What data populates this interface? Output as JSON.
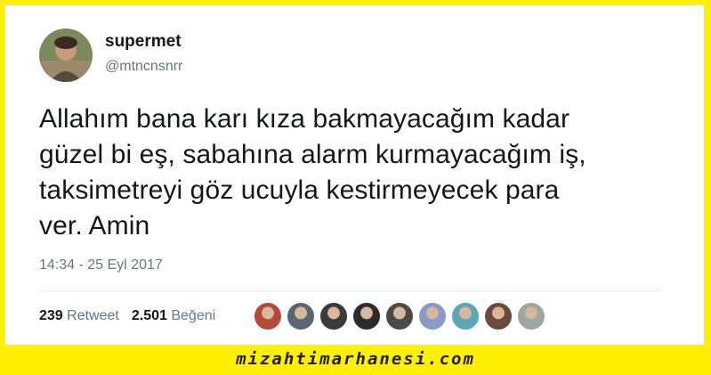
{
  "tweet": {
    "display_name": "supermet",
    "handle": "@mtncnsnrr",
    "text_lines": [
      "Allahım bana karı kıza bakmayacağım kadar",
      "güzel bi eş, sabahına alarm kurmayacağım iş,",
      "taksimetreyi göz ucuyla kestirmeyecek para",
      "ver. Amin"
    ],
    "timestamp": "14:34 - 25 Eyl 2017",
    "retweet_count": "239",
    "retweet_label": "Retweet",
    "like_count": "2.501",
    "like_label": "Beğeni"
  },
  "liker_avatars": [
    {
      "icon": "user-avatar-icon",
      "color": "#b34a3a"
    },
    {
      "icon": "user-avatar-icon",
      "color": "#5a6670"
    },
    {
      "icon": "user-avatar-icon",
      "color": "#3a3a3a"
    },
    {
      "icon": "user-avatar-icon",
      "color": "#2c2c2c"
    },
    {
      "icon": "user-avatar-icon",
      "color": "#4a4a4a"
    },
    {
      "icon": "user-avatar-icon",
      "color": "#8a9ac8"
    },
    {
      "icon": "user-avatar-icon",
      "color": "#5aa7b8"
    },
    {
      "icon": "user-avatar-icon",
      "color": "#6a4a3a"
    },
    {
      "icon": "user-avatar-icon",
      "color": "#9aa8a0"
    }
  ],
  "watermark": "mizahtimarhanesi.com",
  "colors": {
    "background_frame": "#ffef00",
    "secondary_text": "#657786",
    "primary_text": "#14171a"
  }
}
